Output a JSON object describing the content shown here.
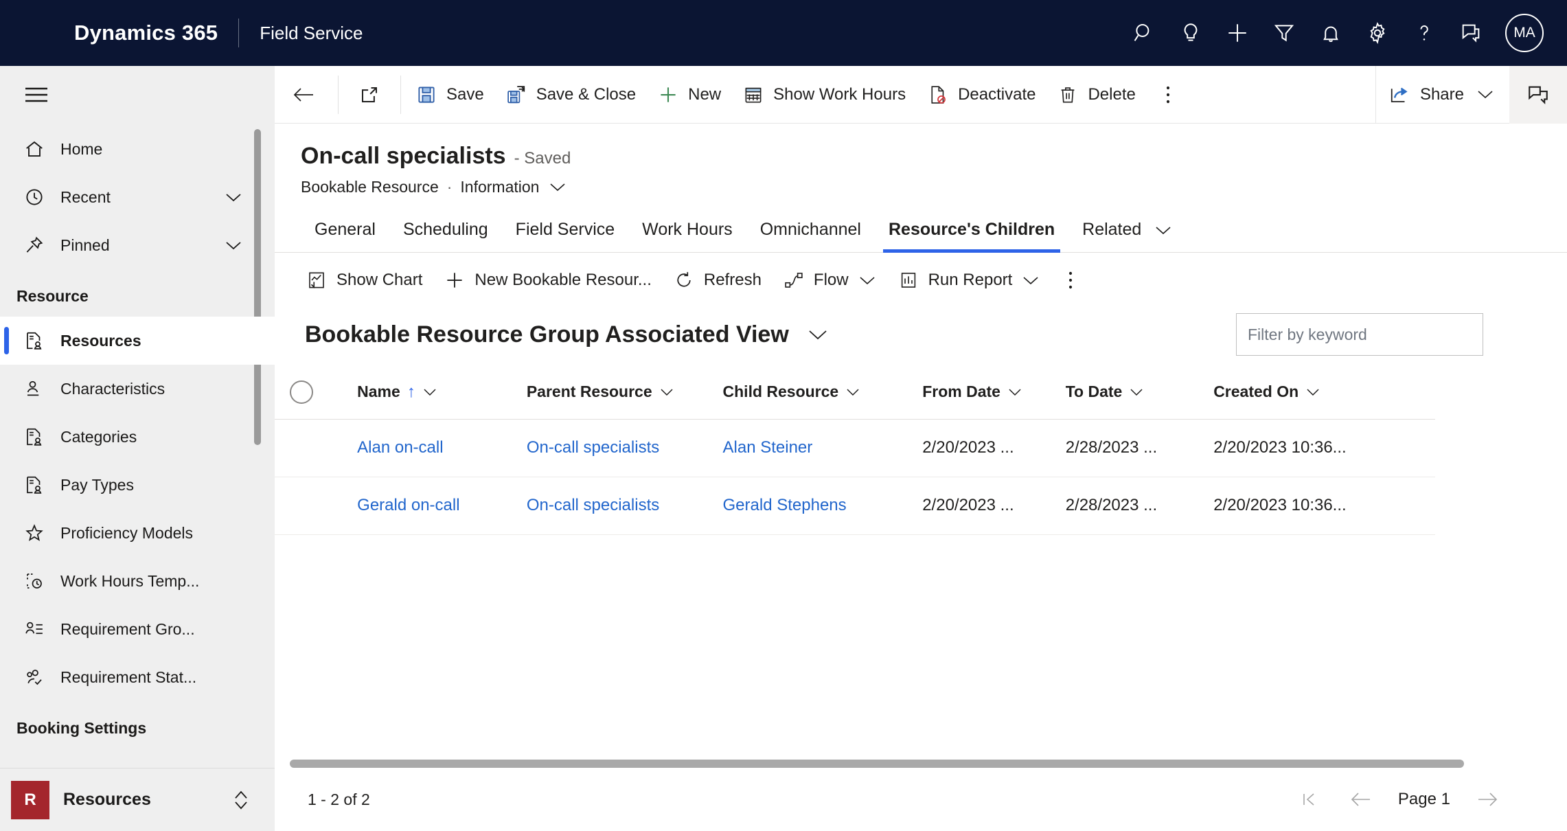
{
  "header": {
    "brand": "Dynamics 365",
    "app": "Field Service",
    "icons": [
      {
        "name": "search-icon",
        "label": "Search"
      },
      {
        "name": "lightbulb-icon",
        "label": "Insights"
      },
      {
        "name": "plus-icon",
        "label": "Quick create"
      },
      {
        "name": "filter-icon",
        "label": "Filter"
      },
      {
        "name": "bell-icon",
        "label": "Notifications"
      },
      {
        "name": "gear-icon",
        "label": "Settings"
      },
      {
        "name": "question-icon",
        "label": "Help"
      },
      {
        "name": "feedback-icon",
        "label": "Feedback"
      }
    ],
    "avatar_initials": "MA",
    "background": "#0b1533"
  },
  "sidebar": {
    "top_items": [
      {
        "label": "Home",
        "icon": "home-icon",
        "chevron": false
      },
      {
        "label": "Recent",
        "icon": "clock-icon",
        "chevron": true
      },
      {
        "label": "Pinned",
        "icon": "pin-icon",
        "chevron": true
      }
    ],
    "group_title": "Resource",
    "items": [
      {
        "label": "Resources",
        "icon": "resource-icon",
        "selected": true
      },
      {
        "label": "Characteristics",
        "icon": "characteristic-icon",
        "selected": false
      },
      {
        "label": "Categories",
        "icon": "resource-icon",
        "selected": false
      },
      {
        "label": "Pay Types",
        "icon": "resource-icon",
        "selected": false
      },
      {
        "label": "Proficiency Models",
        "icon": "star-icon",
        "selected": false
      },
      {
        "label": "Work Hours Temp...",
        "icon": "work-hours-template-icon",
        "selected": false
      },
      {
        "label": "Requirement Gro...",
        "icon": "requirement-group-icon",
        "selected": false
      },
      {
        "label": "Requirement Stat...",
        "icon": "requirement-status-icon",
        "selected": false
      }
    ],
    "group_title_2": "Booking Settings",
    "area_switcher": {
      "badge": "R",
      "label": "Resources"
    }
  },
  "commandbar": {
    "back_icon": "back-arrow-icon",
    "popout_icon": "open-in-new-window-icon",
    "buttons": [
      {
        "label": "Save",
        "icon": "save-icon"
      },
      {
        "label": "Save & Close",
        "icon": "save-and-close-icon"
      },
      {
        "label": "New",
        "icon": "plus-icon"
      },
      {
        "label": "Show Work Hours",
        "icon": "calendar-icon"
      },
      {
        "label": "Deactivate",
        "icon": "deactivate-icon"
      },
      {
        "label": "Delete",
        "icon": "trash-icon"
      }
    ],
    "overflow_label": "More commands",
    "share_label": "Share",
    "copilot_label": "Copilot"
  },
  "record": {
    "title": "On-call specialists",
    "saved_status": "- Saved",
    "entity": "Bookable Resource",
    "form_name": "Information"
  },
  "form_tabs": [
    {
      "label": "General",
      "active": false
    },
    {
      "label": "Scheduling",
      "active": false
    },
    {
      "label": "Field Service",
      "active": false
    },
    {
      "label": "Work Hours",
      "active": false
    },
    {
      "label": "Omnichannel",
      "active": false
    },
    {
      "label": "Resource's Children",
      "active": true
    },
    {
      "label": "Related",
      "active": false,
      "chevron": true
    }
  ],
  "subgrid": {
    "commands": [
      {
        "label": "Show Chart",
        "icon": "show-chart-icon",
        "chevron": false
      },
      {
        "label": "New Bookable Resour...",
        "icon": "plus-icon",
        "chevron": false
      },
      {
        "label": "Refresh",
        "icon": "refresh-icon",
        "chevron": false
      },
      {
        "label": "Flow",
        "icon": "flow-icon",
        "chevron": true
      },
      {
        "label": "Run Report",
        "icon": "report-icon",
        "chevron": true
      }
    ],
    "overflow_label": "More commands",
    "view_name": "Bookable Resource Group Associated View",
    "search_placeholder": "Filter by keyword",
    "search_value": "",
    "columns": [
      {
        "label": "Name",
        "sorted": "asc"
      },
      {
        "label": "Parent Resource",
        "sorted": ""
      },
      {
        "label": "Child Resource",
        "sorted": ""
      },
      {
        "label": "From Date",
        "sorted": ""
      },
      {
        "label": "To Date",
        "sorted": ""
      },
      {
        "label": "Created On",
        "sorted": ""
      }
    ],
    "rows": [
      {
        "name": "Alan on-call",
        "parent_resource": "On-call specialists",
        "child_resource": "Alan Steiner",
        "from_date": "2/20/2023 ...",
        "to_date": "2/28/2023 ...",
        "created_on": "2/20/2023 10:36..."
      },
      {
        "name": "Gerald on-call",
        "parent_resource": "On-call specialists",
        "child_resource": "Gerald Stephens",
        "from_date": "2/20/2023 ...",
        "to_date": "2/28/2023 ...",
        "created_on": "2/20/2023 10:36..."
      }
    ],
    "footer": {
      "count_text": "1 - 2 of 2",
      "page_label": "Page 1"
    }
  },
  "colors": {
    "header_bg": "#0b1533",
    "accent_blue": "#2d63e8",
    "link_blue": "#2266cc",
    "area_badge": "#a4262c",
    "sidebar_bg": "#efefef"
  }
}
